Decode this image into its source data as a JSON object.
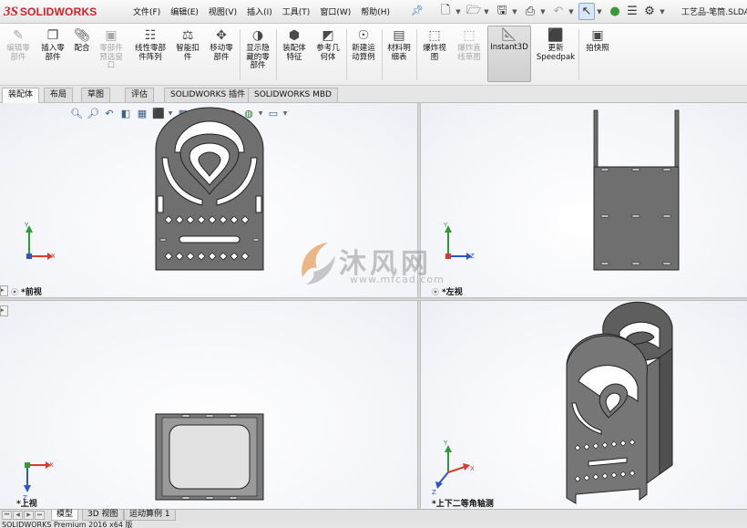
{
  "app": {
    "logo_mark": "3S",
    "logo_text": "SOLIDWORKS",
    "document_title": "工艺品-笔筒.SLDA"
  },
  "menu": [
    "文件(F)",
    "编辑(E)",
    "视图(V)",
    "插入(I)",
    "工具(T)",
    "窗口(W)",
    "帮助(H)"
  ],
  "quick_access": {
    "icons": [
      "new-icon",
      "open-icon",
      "save-icon",
      "print-icon",
      "undo-icon",
      "select-icon",
      "rebuild-icon",
      "file-properties-icon",
      "options-icon"
    ]
  },
  "ribbon": {
    "tools": [
      {
        "label": "编辑零\n部件",
        "icon": "edit-part-icon",
        "enabled": false
      },
      {
        "label": "插入零\n部件",
        "icon": "insert-component-icon",
        "enabled": true
      },
      {
        "label": "配合",
        "icon": "mate-icon",
        "enabled": true
      },
      {
        "label": "零部件\n预选窗\n口",
        "icon": "component-preview-icon",
        "enabled": false
      },
      {
        "label": "线性零部\n件阵列",
        "icon": "linear-pattern-icon",
        "enabled": true
      },
      {
        "label": "智能扣\n件",
        "icon": "smart-fasteners-icon",
        "enabled": true
      },
      {
        "label": "移动零\n部件",
        "icon": "move-component-icon",
        "enabled": true
      },
      {
        "label": "显示隐\n藏的零\n部件",
        "icon": "show-hidden-icon",
        "enabled": true
      },
      {
        "label": "装配体\n特征",
        "icon": "assembly-features-icon",
        "enabled": true
      },
      {
        "label": "参考几\n何体",
        "icon": "reference-geometry-icon",
        "enabled": true
      },
      {
        "label": "新建运\n动算例",
        "icon": "new-motion-study-icon",
        "enabled": true
      },
      {
        "label": "材料明\n细表",
        "icon": "bill-of-materials-icon",
        "enabled": true
      },
      {
        "label": "爆炸视\n图",
        "icon": "exploded-view-icon",
        "enabled": true
      },
      {
        "label": "爆炸直\n线草图",
        "icon": "explode-line-sketch-icon",
        "enabled": false
      },
      {
        "label": "Instant3D",
        "icon": "instant3d-icon",
        "enabled": true,
        "active": true
      },
      {
        "label": "更新\nSpeedpak",
        "icon": "speedpak-icon",
        "enabled": true
      },
      {
        "label": "拍快照",
        "icon": "snapshot-icon",
        "enabled": true
      }
    ]
  },
  "tabs": [
    {
      "label": "装配体",
      "active": true
    },
    {
      "label": "布局",
      "active": false
    },
    {
      "label": "草图",
      "active": false
    },
    {
      "label": "评估",
      "active": false
    },
    {
      "label": "SOLIDWORKS 插件",
      "active": false
    },
    {
      "label": "SOLIDWORKS MBD",
      "active": false
    }
  ],
  "viewports": {
    "front": {
      "label": "*前视"
    },
    "left": {
      "label": "*左视"
    },
    "top": {
      "label": "*上视"
    },
    "iso": {
      "label": "*上下二等角轴测"
    }
  },
  "triad": {
    "x": "X",
    "y": "Y",
    "z": "Z"
  },
  "watermark": {
    "text": "沐风网",
    "url": "www.mfcad.com"
  },
  "bottom_tabs": [
    {
      "label": "模型",
      "active": true
    },
    {
      "label": "3D 视图",
      "active": false
    },
    {
      "label": "运动算例 1",
      "active": false
    }
  ],
  "status": {
    "text": "SOLIDWORKS Premium 2016 x64 版"
  },
  "colors": {
    "brand": "#d32027",
    "part": "#6f6f6f",
    "part_edge": "#222222",
    "axis_x": "#d93a2b",
    "axis_y": "#2f9a3a",
    "axis_z": "#2d55c8"
  }
}
